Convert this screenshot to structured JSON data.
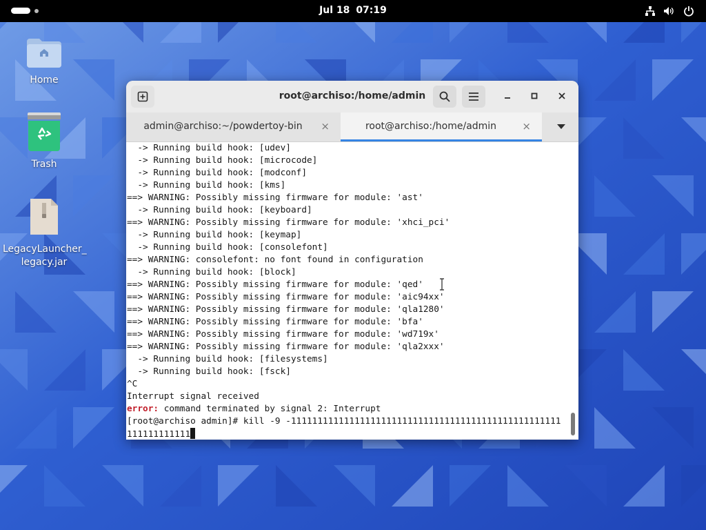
{
  "topbar": {
    "date": "Jul 18",
    "time": "07:19",
    "icons": [
      "network-icon",
      "volume-icon",
      "power-icon"
    ]
  },
  "desktop": {
    "items": [
      {
        "label": "Home",
        "icon": "home-folder-icon"
      },
      {
        "label": "Trash",
        "icon": "trash-icon"
      },
      {
        "label_line1": "LegacyLauncher_",
        "label_line2": "legacy.jar",
        "icon": "jar-file-icon"
      }
    ]
  },
  "terminal_window": {
    "title": "root@archiso:/home/admin",
    "tabs": [
      {
        "label": "admin@archiso:~/powdertoy-bin",
        "active": false
      },
      {
        "label": "root@archiso:/home/admin",
        "active": true
      }
    ],
    "close_glyph": "×",
    "accent_color": "#3584e4",
    "error_color": "#c01c28",
    "output": {
      "lines": [
        "  -> Running build hook: [udev]",
        "  -> Running build hook: [microcode]",
        "  -> Running build hook: [modconf]",
        "  -> Running build hook: [kms]",
        "==> WARNING: Possibly missing firmware for module: 'ast'",
        "  -> Running build hook: [keyboard]",
        "==> WARNING: Possibly missing firmware for module: 'xhci_pci'",
        "  -> Running build hook: [keymap]",
        "  -> Running build hook: [consolefont]",
        "==> WARNING: consolefont: no font found in configuration",
        "  -> Running build hook: [block]",
        "==> WARNING: Possibly missing firmware for module: 'qed'",
        "==> WARNING: Possibly missing firmware for module: 'aic94xx'",
        "==> WARNING: Possibly missing firmware for module: 'qla1280'",
        "==> WARNING: Possibly missing firmware for module: 'bfa'",
        "==> WARNING: Possibly missing firmware for module: 'wd719x'",
        "==> WARNING: Possibly missing firmware for module: 'qla2xxx'",
        "  -> Running build hook: [filesystems]",
        "  -> Running build hook: [fsck]",
        "^C",
        "Interrupt signal received"
      ],
      "error_prefix": "error:",
      "error_message": " command terminated by signal 2: Interrupt",
      "prompt_line1": "[root@archiso admin]# kill -9 -111111111111111111111111111111111111111111111111111",
      "prompt_line2": "111111111111"
    }
  }
}
